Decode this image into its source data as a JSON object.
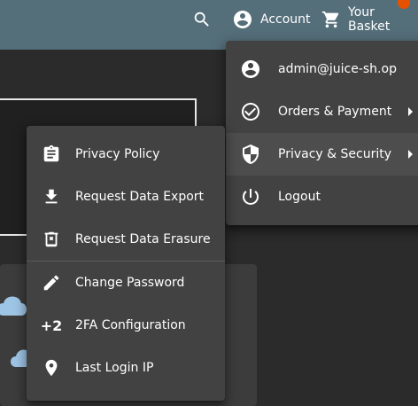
{
  "toolbar": {
    "search_icon": "search-icon",
    "account_label": "Account",
    "basket_label": "Your Basket",
    "color": "#546e7a"
  },
  "account_menu": {
    "items": [
      {
        "label": "admin@juice-sh.op",
        "icon": "account-circle-icon"
      },
      {
        "label": "Orders & Payment",
        "icon": "check-circle-icon"
      },
      {
        "label": "Privacy & Security",
        "icon": "shield-icon"
      },
      {
        "label": "Logout",
        "icon": "power-icon"
      }
    ]
  },
  "privacy_menu": {
    "items": [
      {
        "label": "Privacy Policy",
        "icon": "clipboard-icon"
      },
      {
        "label": "Request Data Export",
        "icon": "download-icon"
      },
      {
        "label": "Request Data Erasure",
        "icon": "delete-icon"
      },
      {
        "label": "Change Password",
        "icon": "pencil-icon"
      },
      {
        "label": "2FA Configuration",
        "icon": "plus-two-icon"
      },
      {
        "label": "Last Login IP",
        "icon": "location-pin-icon"
      }
    ]
  },
  "plus_two_glyph": "+2"
}
